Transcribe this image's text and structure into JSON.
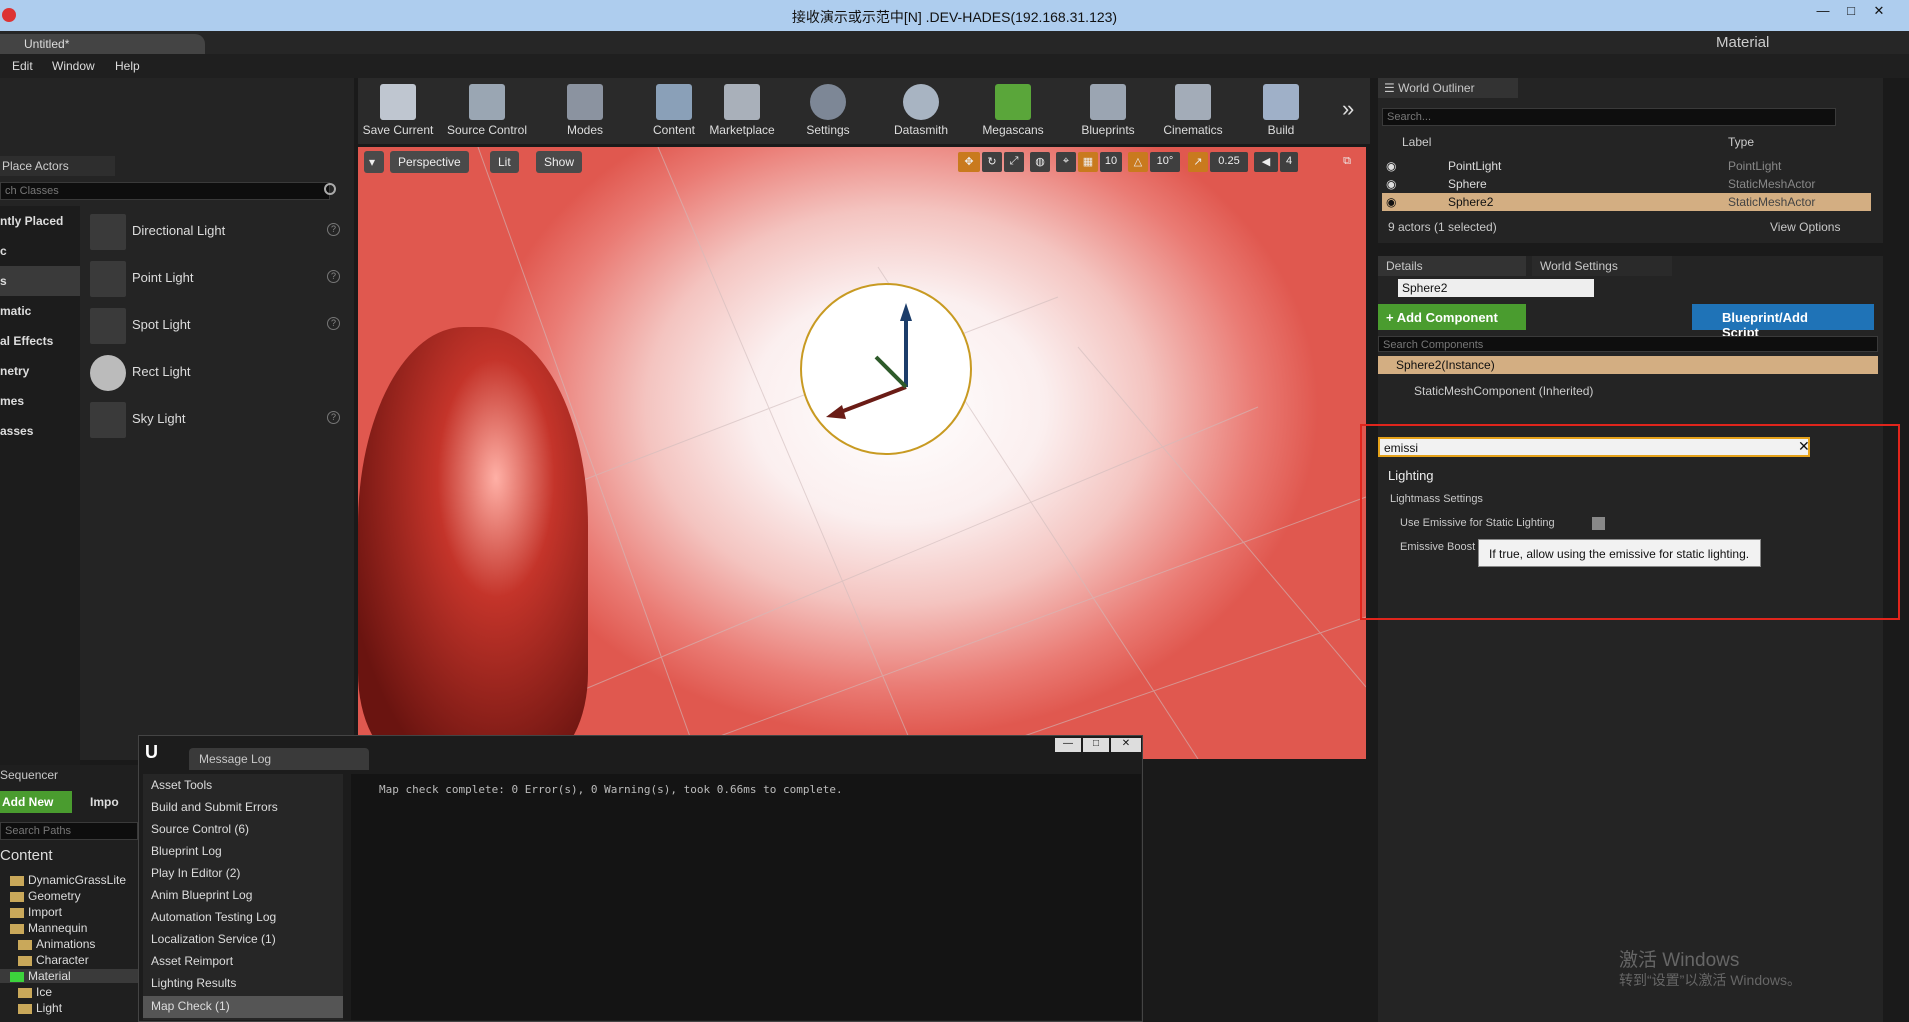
{
  "window": {
    "title": "接收演示或示范中[N] .DEV-HADES(192.168.31.123)",
    "doc_tab": "Untitled*",
    "project_label": "Material"
  },
  "menu": [
    "Edit",
    "Window",
    "Help"
  ],
  "place_actors": {
    "tab": "Place Actors",
    "search_placeholder": "ch Classes",
    "categories": [
      "ntly Placed",
      "c",
      "s",
      "matic",
      "al Effects",
      "netry",
      "mes",
      "asses"
    ],
    "items": [
      {
        "label": "Directional Light",
        "icon": "directional-light-icon"
      },
      {
        "label": "Point Light",
        "icon": "point-light-icon"
      },
      {
        "label": "Spot Light",
        "icon": "spot-light-icon"
      },
      {
        "label": "Rect Light",
        "icon": "rect-light-icon"
      },
      {
        "label": "Sky Light",
        "icon": "sky-light-icon"
      }
    ],
    "help": "?"
  },
  "toolbar": {
    "items": [
      "Save Current",
      "Source Control",
      "Modes",
      "Content",
      "Marketplace",
      "Settings",
      "Datasmith",
      "Megascans",
      "Blueprints",
      "Cinematics",
      "Build"
    ],
    "more": "»"
  },
  "viewport": {
    "perspective": "Perspective",
    "lit": "Lit",
    "show": "Show",
    "grid": "10",
    "angle": "10°",
    "scale": "0.25",
    "speed": "4"
  },
  "outliner": {
    "tab": "World Outliner",
    "search_placeholder": "Search...",
    "col_label": "Label",
    "col_type": "Type",
    "rows": [
      {
        "label": "PointLight",
        "type": "PointLight"
      },
      {
        "label": "Sphere",
        "type": "StaticMeshActor"
      },
      {
        "label": "Sphere2",
        "type": "StaticMeshActor"
      }
    ],
    "status": "9 actors (1 selected)",
    "view_options": "View Options"
  },
  "details": {
    "tab": "Details",
    "tab2": "World Settings",
    "name_value": "Sphere2",
    "add_component": "+ Add Component",
    "blueprint": "Blueprint/Add Script",
    "search_components_placeholder": "Search Components",
    "instance": "Sphere2(Instance)",
    "component": "StaticMeshComponent (Inherited)",
    "filter_value": "emissi",
    "section": "Lighting",
    "subsection": "Lightmass Settings",
    "prop1": "Use Emissive for Static Lighting",
    "prop2": "Emissive Boost",
    "tooltip": "If true, allow using the emissive for static lighting."
  },
  "message_log": {
    "tab": "Message Log",
    "categories": [
      "Asset Tools",
      "Build and Submit Errors",
      "Source Control (6)",
      "Blueprint Log",
      "Play In Editor (2)",
      "Anim Blueprint Log",
      "Automation Testing Log",
      "Localization Service (1)",
      "Asset Reimport",
      "Lighting Results",
      "Map Check (1)"
    ],
    "message": "Map check complete: 0 Error(s), 0 Warning(s), took 0.66ms to complete."
  },
  "content_browser": {
    "sequencer_tab": "Sequencer",
    "add_new": "Add New",
    "import": "Impo",
    "search_paths": "Search Paths",
    "root": "Content",
    "folders": [
      "DynamicGrassLite",
      "Geometry",
      "Import",
      "Mannequin",
      "Animations",
      "Character",
      "Material",
      "Ice",
      "Light"
    ]
  },
  "watermark": {
    "line1": "激活 Windows",
    "line2": "转到“设置”以激活 Windows。"
  }
}
